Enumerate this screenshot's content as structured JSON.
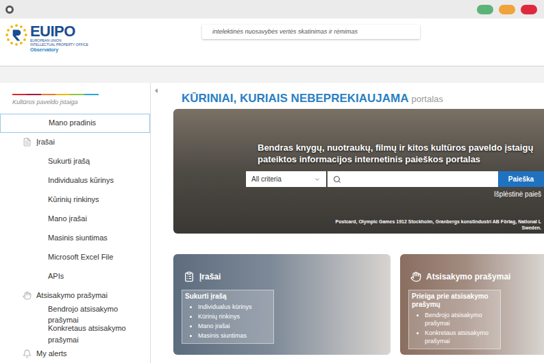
{
  "window": {
    "controls": [
      {
        "color": "#5cb377"
      },
      {
        "color": "#f0a23b"
      },
      {
        "color": "#df2a3d"
      }
    ]
  },
  "header": {
    "logo": {
      "name": "EUIPO",
      "subtitle": [
        "EUROPEAN UNION",
        "INTELLECTUAL PROPERTY OFFICE"
      ],
      "program": "Observatory"
    },
    "tagline": "intelektinės nuosavybės vertės skatinimas ir rėmimas"
  },
  "sidebar": {
    "role": "Kultūros paveldo įstaiga",
    "items": [
      {
        "label": "Mano pradinis",
        "kind": "home",
        "selected": true
      },
      {
        "label": "Įrašai",
        "kind": "group",
        "selected": false
      },
      {
        "label": "Sukurti įrašą",
        "kind": "item",
        "selected": false
      },
      {
        "label": "Individualus kūrinys",
        "kind": "item",
        "selected": false
      },
      {
        "label": "Kūrinių rinkinys",
        "kind": "item",
        "selected": false
      },
      {
        "label": "Mano įrašai",
        "kind": "item",
        "selected": false
      },
      {
        "label": "Masinis siuntimas",
        "kind": "item",
        "selected": false
      },
      {
        "label": "Microsoft Excel File",
        "kind": "item",
        "selected": false
      },
      {
        "label": "APIs",
        "kind": "item",
        "selected": false
      },
      {
        "label": "Atsisakymo prašymai",
        "kind": "group",
        "selected": false
      },
      {
        "label": "Bendrojo atsisakymo prašymai",
        "kind": "item",
        "selected": false
      },
      {
        "label": "Konkretaus atsisakymo prašymai",
        "kind": "item",
        "selected": false
      },
      {
        "label": "My alerts",
        "kind": "group",
        "selected": false
      }
    ]
  },
  "portal": {
    "title": "KŪRINIAI, KURIAIS NEBEPREKIAUJAMA",
    "suffix": "portalas"
  },
  "hero": {
    "heading": [
      "Bendras knygų, nuotraukų, filmų ir kitos kultūros paveldo įstaigų",
      "pateiktos informacijos internetinis paieškos portalas"
    ],
    "select": "All criteria",
    "search_value": "",
    "button": "Paieška",
    "advanced": "Išplėstinė paieš",
    "caption": [
      "Postcard, Olympic Games 1912 Stockholm, Granbergs konstindustri AB Förlag, National L",
      "Sweden."
    ]
  },
  "cards": [
    {
      "title": "Įrašai",
      "box_title": "Sukurti įrašą",
      "links": [
        "Individualus kūrinys",
        "Kūrinių rinkinys",
        "Mano įrašai",
        "Masinis siuntimas"
      ],
      "color": "#5d6c7e"
    },
    {
      "title": "Atsisakymo prašymai",
      "box_title": "Prieiga prie atsisakymo prašymų",
      "links": [
        "Bendrojo atsisakymo prašymai",
        "Konkretaus atsisakymo prašymai"
      ],
      "color": "#8a6e60"
    }
  ]
}
